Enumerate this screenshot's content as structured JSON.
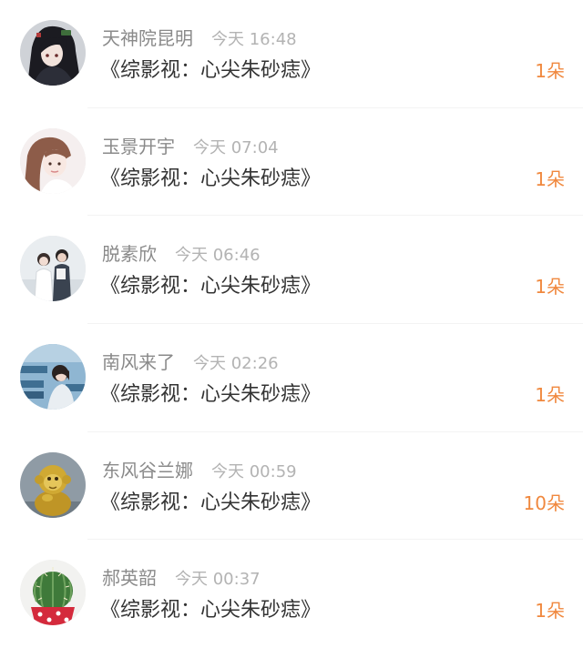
{
  "items": [
    {
      "username": "天神院昆明",
      "time": "今天 16:48",
      "title": "《综影视：心尖朱砂痣》",
      "count": "1朵"
    },
    {
      "username": "玉景开宇",
      "time": "今天 07:04",
      "title": "《综影视：心尖朱砂痣》",
      "count": "1朵"
    },
    {
      "username": "脱素欣",
      "time": "今天 06:46",
      "title": "《综影视：心尖朱砂痣》",
      "count": "1朵"
    },
    {
      "username": "南风来了",
      "time": "今天 02:26",
      "title": "《综影视：心尖朱砂痣》",
      "count": "1朵"
    },
    {
      "username": "东风谷兰娜",
      "time": "今天 00:59",
      "title": "《综影视：心尖朱砂痣》",
      "count": "10朵"
    },
    {
      "username": "郝英韶",
      "time": "今天 00:37",
      "title": "《综影视：心尖朱砂痣》",
      "count": "1朵"
    }
  ],
  "colors": {
    "accent": "#f0883e",
    "username": "#8a8a8a",
    "time": "#b3b3b3",
    "title": "#333333",
    "background": "#ffffff"
  }
}
